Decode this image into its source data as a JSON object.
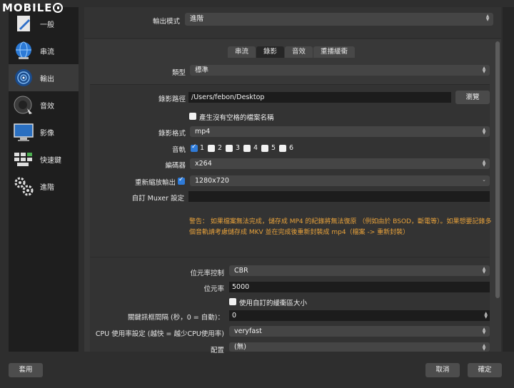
{
  "watermark": {
    "text": "MOBILE"
  },
  "sidebar": {
    "items": [
      {
        "label": "一般"
      },
      {
        "label": "串流"
      },
      {
        "label": "輸出"
      },
      {
        "label": "音效"
      },
      {
        "label": "影像"
      },
      {
        "label": "快速鍵"
      },
      {
        "label": "進階"
      }
    ]
  },
  "output_mode": {
    "label": "輸出模式",
    "value": "進階"
  },
  "tabs": [
    {
      "label": "串流"
    },
    {
      "label": "錄影"
    },
    {
      "label": "音效"
    },
    {
      "label": "重播緩衝"
    }
  ],
  "recording": {
    "type_label": "類型",
    "type_value": "標準",
    "path_label": "錄影路徑",
    "path_value": "/Users/febon/Desktop",
    "browse_label": "瀏覽",
    "nospace_label": "產生沒有空格的檔案名稱",
    "format_label": "錄影格式",
    "format_value": "mp4",
    "tracks_label": "音軌",
    "tracks": [
      "1",
      "2",
      "3",
      "4",
      "5",
      "6"
    ],
    "encoder_label": "編碼器",
    "encoder_value": "x264",
    "rescale_label": "重新縮放輸出",
    "rescale_value": "1280x720",
    "muxer_label": "自訂 Muxer 設定",
    "muxer_value": "",
    "warning": "警告： 如果檔案無法完成，儲存成 MP4 的紀錄將無法復原 （例如由於 BSOD，斷電等）。如果想要記錄多個音軌請考慮儲存成 MKV 並在完成後重新封裝成 mp4（檔案 -> 重新封裝）"
  },
  "encoder": {
    "ratecontrol_label": "位元率控制",
    "ratecontrol_value": "CBR",
    "bitrate_label": "位元率",
    "bitrate_value": "5000",
    "custom_buffer_label": "使用自訂的緩衝區大小",
    "keyframe_label": "關鍵訊框間隔 (秒，0 = 自動)：",
    "keyframe_value": "0",
    "cpu_label": "CPU 使用率設定 (越快 = 越少CPU使用率)",
    "cpu_value": "veryfast",
    "profile_label": "配置",
    "profile_value": "(無)"
  },
  "footer": {
    "apply_label": "套用",
    "cancel_label": "取消",
    "ok_label": "確定"
  },
  "colors": {
    "accent": "#2f7bd8",
    "warning": "#e8a23b",
    "sidebar_bg": "#1e1e1e"
  }
}
